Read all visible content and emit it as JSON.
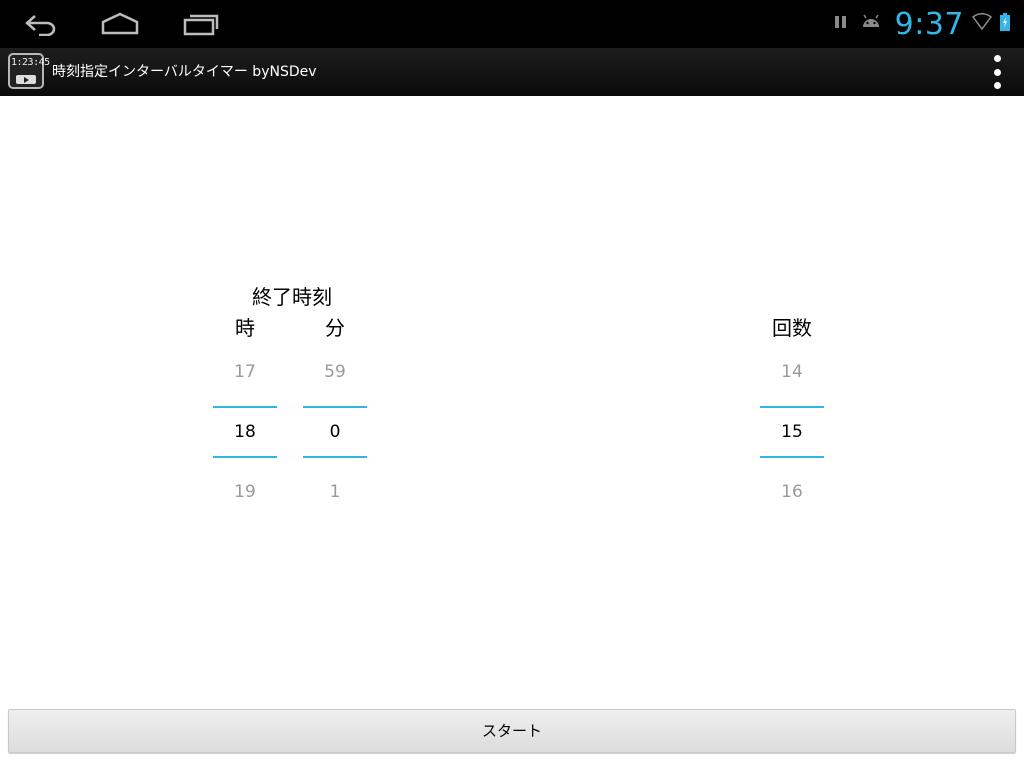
{
  "status_bar": {
    "time": "9:37",
    "nav": [
      "back-icon",
      "home-icon",
      "recent-apps-icon"
    ],
    "icons": [
      "pause-icon",
      "android-debug-icon",
      "wifi-icon",
      "battery-charging-icon"
    ],
    "accent_color": "#33b5e5"
  },
  "action_bar": {
    "app_icon_digits": "1:23:45",
    "title": "時刻指定インターバルタイマー byNSDev",
    "overflow_icon": "overflow-menu-icon"
  },
  "end_time": {
    "title": "終了時刻",
    "hour": {
      "label": "時",
      "prev": "17",
      "current": "18",
      "next": "19"
    },
    "minute": {
      "label": "分",
      "prev": "59",
      "current": "0",
      "next": "1"
    }
  },
  "count": {
    "label": "回数",
    "prev": "14",
    "current": "15",
    "next": "16"
  },
  "start_button": {
    "label": "スタート"
  }
}
